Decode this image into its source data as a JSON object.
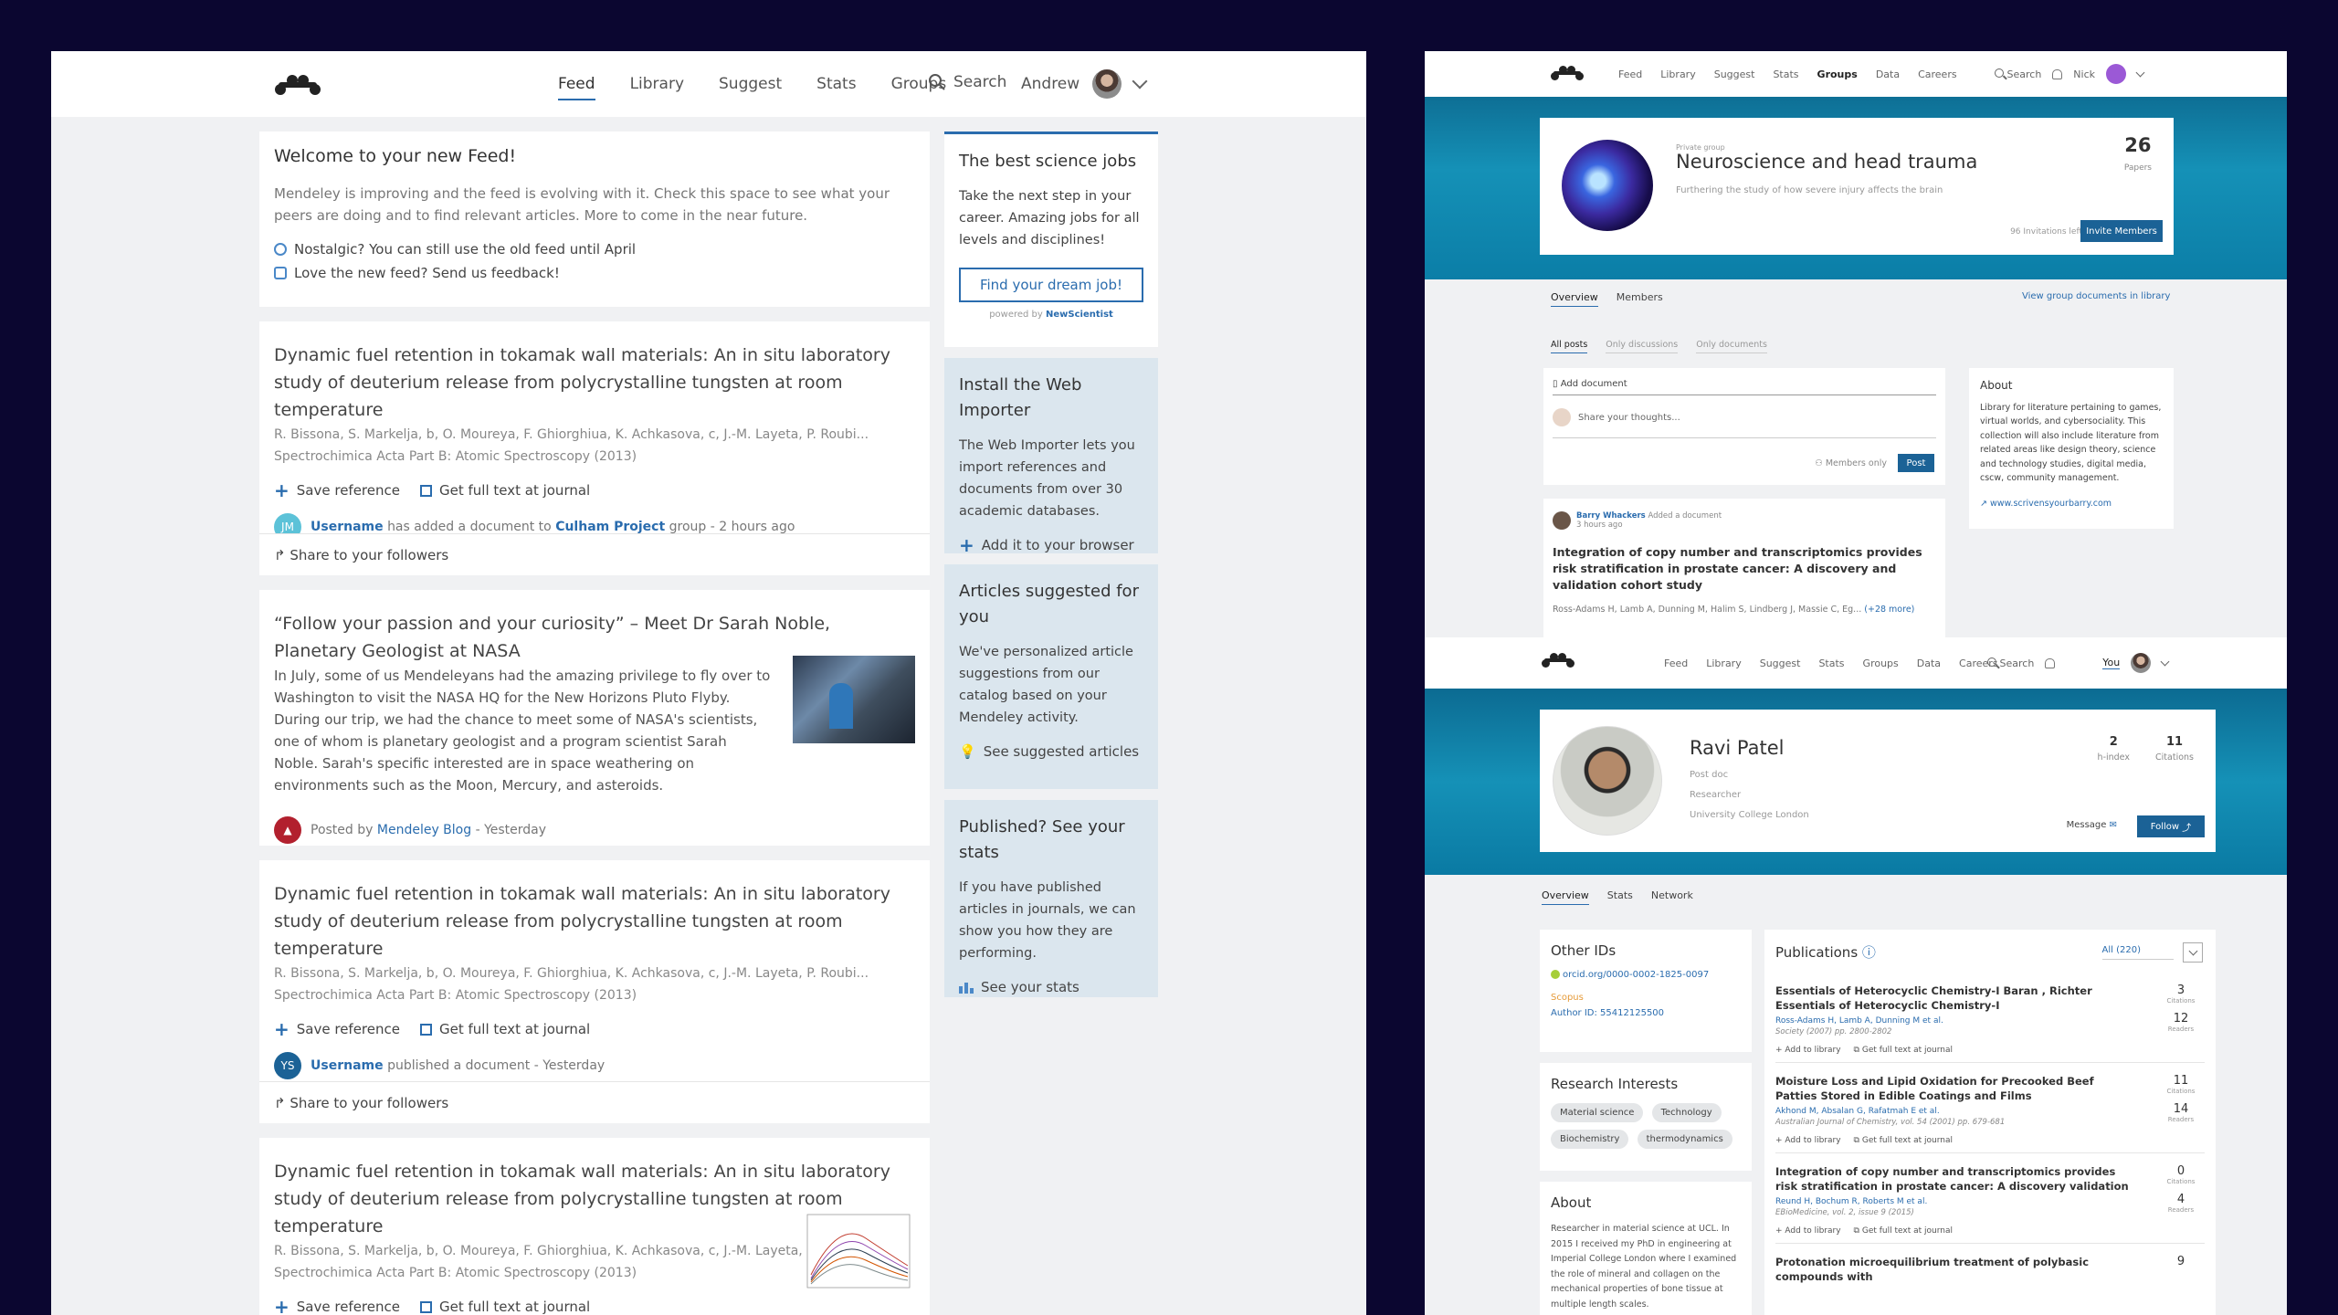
{
  "feed_app": {
    "nav": {
      "links": [
        "Feed",
        "Library",
        "Suggest",
        "Stats",
        "Groups"
      ],
      "active": "Feed",
      "search": "Search",
      "user": "Andrew"
    },
    "welcome": {
      "title": "Welcome to your new Feed!",
      "body": "Mendeley is improving and the feed is evolving with it. Check this space to see what your peers are doing and to find relevant articles. More to come in the near future.",
      "line1": "Nostalgic? You can still use the old feed until April",
      "line2": "Love the new feed? Send us feedback!"
    },
    "article1": {
      "title": "Dynamic fuel retention in tokamak wall materials: An in situ laboratory study of deuterium release from polycrystalline tungsten at room temperature",
      "authors": "R. Bissona, S. Markelja, b, O. Moureya, F. Ghiorghiua, K. Achkasova, c, J.-M. Layeta, P. Roubi...",
      "journal": "Spectrochimica Acta Part B: Atomic Spectroscopy (2013)",
      "save": "Save reference",
      "fulltext": "Get full text at journal",
      "initials": "JM",
      "user": "Username",
      "action1": "has added a document to",
      "group": "Culham Project",
      "action2": "group - 2 hours ago",
      "share": "Share to your followers"
    },
    "blog": {
      "title": "“Follow your passion and your curiosity” – Meet Dr Sarah Noble, Planetary Geologist at NASA",
      "body": "In July, some of us Mendeleyans had the amazing privilege to fly over to Washington to visit the NASA HQ for the New Horizons Pluto Flyby. During our trip, we had the chance to meet some of NASA's scientists, one of whom is planetary geologist and a program scientist Sarah Noble. Sarah's specific interested are in space weathering on environments such as the Moon, Mercury, and asteroids.",
      "posted_by": "Posted by",
      "source": "Mendeley Blog",
      "when": "- Yesterday"
    },
    "article2": {
      "title": "Dynamic fuel retention in tokamak wall materials: An in situ laboratory study of deuterium release from polycrystalline tungsten at room temperature",
      "authors": "R. Bissona, S. Markelja, b, O. Moureya, F. Ghiorghiua, K. Achkasova, c, J.-M. Layeta, P. Roubi...",
      "journal": "Spectrochimica Acta Part B: Atomic Spectroscopy (2013)",
      "save": "Save reference",
      "fulltext": "Get full text at journal",
      "initials": "YS",
      "user": "Username",
      "action": "published a document - Yesterday",
      "share": "Share to your followers"
    },
    "article3": {
      "title": "Dynamic fuel retention in tokamak wall materials: An in situ laboratory study of deuterium release from polycrystalline tungsten at room temperature",
      "authors": "R. Bissona, S. Markelja, b, O. Moureya, F. Ghiorghiua, K. Achkasova, c, J.-M. Layeta, P. Roubi...",
      "journal": "Spectrochimica Acta Part B: Atomic Spectroscopy (2013)",
      "save": "Save reference",
      "fulltext": "Get full text at journal"
    },
    "sidebar": {
      "jobs": {
        "title": "The best science jobs",
        "body": "Take the next step in your career. Amazing jobs for all levels and disciplines!",
        "button": "Find your dream job!",
        "powered": "powered by",
        "brand": "NewScientist"
      },
      "importer": {
        "title": "Install the Web Importer",
        "body": "The Web Importer lets you import references and documents from over 30 academic databases.",
        "action": "Add it to your browser"
      },
      "suggested": {
        "title": "Articles suggested for you",
        "body": "We've personalized article suggestions from our catalog based on your Mendeley activity.",
        "action": "See suggested articles"
      },
      "stats": {
        "title": "Published? See your stats",
        "body": "If you have published articles in journals, we can show you how they are performing.",
        "action": "See your stats"
      }
    }
  },
  "group_app": {
    "nav": {
      "links": [
        "Feed",
        "Library",
        "Suggest",
        "Stats",
        "Groups",
        "Data",
        "Careers"
      ],
      "active": "Groups",
      "search": "Search",
      "user": "Nick"
    },
    "header": {
      "kicker": "Private group",
      "title": "Neuroscience and head trauma",
      "subtitle": "Furthering the study of how severe injury affects the brain",
      "count": "26",
      "count_label": "Papers",
      "invitations": "96 Invitations left",
      "invite_button": "Invite Members"
    },
    "tabs": [
      "Overview",
      "Members"
    ],
    "view_docs": "View group documents in library",
    "filters": [
      "All posts",
      "Only discussions",
      "Only documents"
    ],
    "composer": {
      "add_doc": "Add document",
      "placeholder": "Share your thoughts...",
      "visibility": "Members only",
      "post": "Post"
    },
    "about": {
      "title": "About",
      "body": "Library for literature pertaining to games, virtual worlds, and cybersociality. This collection will also include literature from related areas like design theory, science and technology studies, digital media, cscw, community management.",
      "link": "www.scrivensyourbarry.com"
    },
    "post": {
      "user": "Barry Whackers",
      "action": "Added a document",
      "time": "3 hours ago",
      "title": "Integration of copy number and transcriptomics provides risk stratification in prostate cancer: A discovery and validation cohort study",
      "authors": "Ross-Adams H, Lamb A, Dunning M, Halim S, Lindberg J, Massie C, Eg...",
      "more": "(+28 more)"
    }
  },
  "profile_app": {
    "nav": {
      "links": [
        "Feed",
        "Library",
        "Suggest",
        "Stats",
        "Groups",
        "Data",
        "Careers"
      ],
      "search": "Search",
      "user": "You"
    },
    "header": {
      "name": "Ravi Patel",
      "role1": "Post doc",
      "role2": "Researcher",
      "org": "University College London",
      "h_index": "2",
      "h_index_label": "h-index",
      "citations": "11",
      "citations_label": "Citations",
      "message": "Message",
      "follow": "Follow"
    },
    "tabs": [
      "Overview",
      "Stats",
      "Network"
    ],
    "other_ids": {
      "title": "Other IDs",
      "orcid": "orcid.org/0000-0002-1825-0097",
      "scopus": "Scopus",
      "author_id": "Author ID: 55412125500"
    },
    "interests": {
      "title": "Research Interests",
      "chips": [
        "Material science",
        "Technology",
        "Biochemistry",
        "thermodynamics"
      ]
    },
    "about": {
      "title": "About",
      "body": "Researcher in material science at UCL. In 2015 I received my PhD in engineering at Imperial College London where I examined the role of mineral and collagen on the mechanical properties of bone tissue at multiple length scales."
    },
    "publications": {
      "title": "Publications",
      "filter": "All (220)",
      "add": "Add to library",
      "fulltext": "Get full text at journal",
      "citations_label": "Citations",
      "readers_label": "Readers",
      "items": [
        {
          "title": "Essentials of Heterocyclic Chemistry-I Baran , Richter Essentials of Heterocyclic Chemistry-I",
          "authors": "Ross-Adams H, Lamb A, Dunning M et al.",
          "source": "Society (2007) pp. 2800-2802",
          "citations": "3",
          "readers": "12"
        },
        {
          "title": "Moisture Loss and Lipid Oxidation for Precooked Beef Patties Stored in Edible Coatings and Films",
          "authors": "Akhond M, Absalan G, Rafatmah E et al.",
          "source": "Australian Journal of Chemistry, vol. 54 (2001) pp. 679-681",
          "citations": "11",
          "readers": "14"
        },
        {
          "title": "Integration of copy number and transcriptomics provides risk stratification in prostate cancer: A discovery validation",
          "authors": "Reund H, Bochum R, Roberts M et al.",
          "source": "EBioMedicine, vol. 2, issue 9 (2015)",
          "citations": "0",
          "readers": "4"
        },
        {
          "title": "Protonation microequilibrium treatment of polybasic compounds with",
          "citations": "9"
        }
      ]
    }
  },
  "colors": {
    "background": "#0b0630",
    "accent": "#2a6cae",
    "hero": "#1591b7",
    "button": "#1b6296"
  },
  "icons": [
    "mendeley-logo",
    "search-icon",
    "chevron-down-icon",
    "plus-icon",
    "external-link-icon",
    "share-icon",
    "bell-icon",
    "lightbulb-icon",
    "bar-chart-icon"
  ]
}
